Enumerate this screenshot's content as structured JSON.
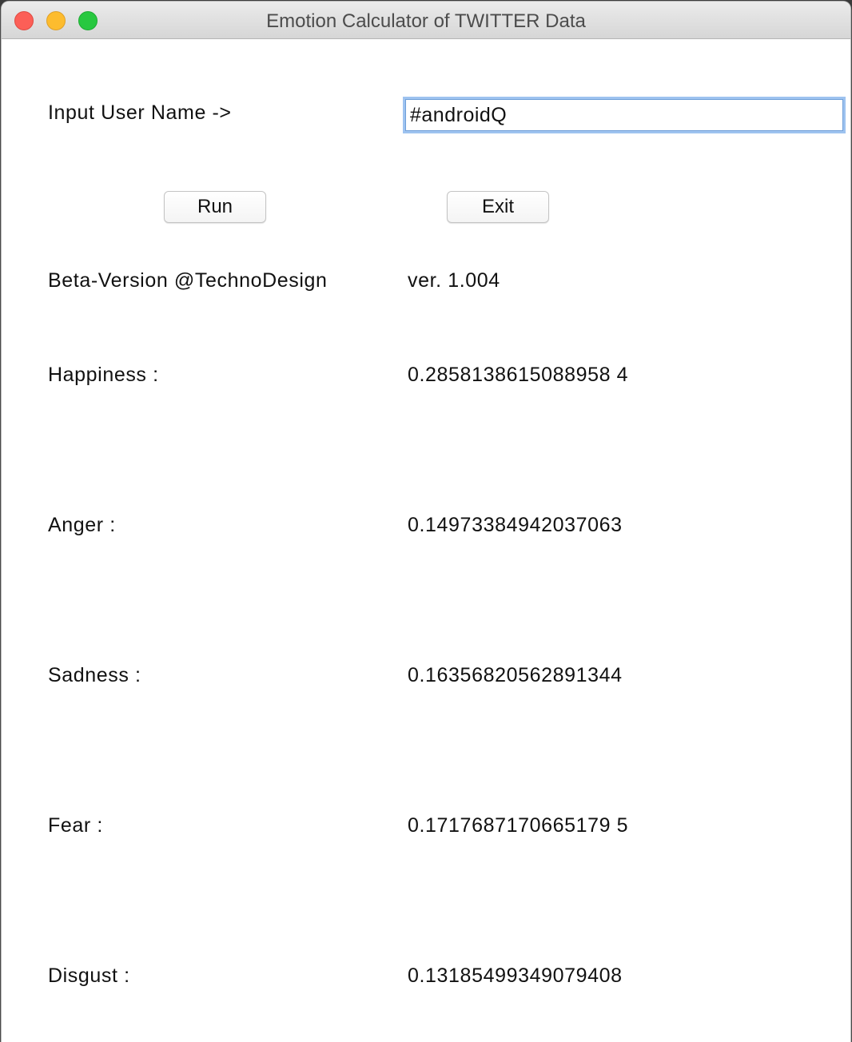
{
  "window": {
    "title": "Emotion Calculator of TWITTER Data"
  },
  "form": {
    "input_label": "Input User Name ->",
    "input_value": "#androidQ"
  },
  "buttons": {
    "run_label": "Run",
    "exit_label": "Exit"
  },
  "info": {
    "credit": "Beta-Version @TechnoDesign",
    "version": "ver. 1.004"
  },
  "emotions": [
    {
      "label": "Happiness :",
      "value": "0.2858138615088958 4"
    },
    {
      "label": "Anger :",
      "value": "0.14973384942037063"
    },
    {
      "label": "Sadness :",
      "value": "0.16356820562891344"
    },
    {
      "label": "Fear :",
      "value": "0.1717687170665179 5"
    },
    {
      "label": "Disgust :",
      "value": "0.13185499349079408"
    }
  ]
}
